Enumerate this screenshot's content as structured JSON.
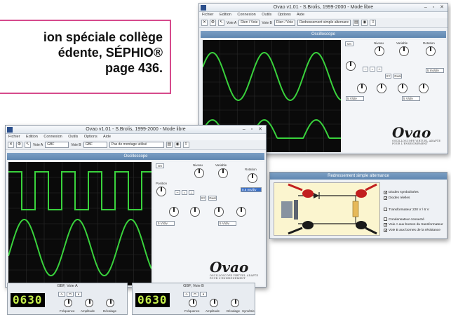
{
  "callout": {
    "line1": "ion spéciale collège",
    "line2": "édente, SÉPHIO®",
    "line3": "page 436."
  },
  "back_window": {
    "title": "Ovao v1.01 - S.Brolis, 1999-2000 - Mode libre",
    "menu": [
      "Fichier",
      "Edition",
      "Connexion",
      "Outils",
      "Options",
      "Aide"
    ],
    "voie_a_label": "Voie A",
    "voie_a_value": "Rien / Voie",
    "voie_b_label": "Voie B",
    "voie_b_value": "Rien / Voie",
    "montage": "Redressement simple alternanc",
    "scope_title": "Oscilloscope",
    "ctrl_labels": {
      "niveau": "Niveau",
      "variable": "Variable",
      "rotation": "Rotation"
    },
    "on_label": "On",
    "time_value": "5 ms/div",
    "volt_a": "5 V/div",
    "volt_b": "5 V/div",
    "logo": "Ovao",
    "logo_sub": "OSCILLOSCOPE VIRTUEL ADAPTE POUR L'ENSEIGNEMENT"
  },
  "front_window": {
    "title": "Ovao v1.01 - S.Brolis, 1999-2000 - Mode libre",
    "menu": [
      "Fichier",
      "Edition",
      "Connexion",
      "Outils",
      "Options",
      "Aide"
    ],
    "voie_a_label": "Voie A",
    "voie_a_value": "GBF",
    "voie_b_label": "Voie B",
    "voie_b_value": "GBF",
    "montage": "Pas de montage utilisé",
    "scope_title": "Oscilloscope",
    "ctrl_labels": {
      "niveau": "Niveau",
      "variable": "Variable",
      "rotation": "Rotation",
      "position": "Position"
    },
    "on_label": "On",
    "time_value": "0.5 ms/div",
    "volt_a": "5 V/div",
    "volt_b": "5 V/div",
    "logo": "Ovao",
    "logo_sub": "OSCILLOSCOPE VIRTUEL ADAPTE POUR L'ENSEIGNEMENT"
  },
  "gbf_a": {
    "title": "GBF, Voie A",
    "display": "0630",
    "knobs": [
      "Fréquence",
      "Amplitude",
      "Décalage"
    ]
  },
  "gbf_b": {
    "title": "GBF, Voie B",
    "display": "0630",
    "knobs": [
      "Fréquence",
      "Amplitude",
      "Décalage"
    ],
    "extra": "Symétrie"
  },
  "redressement": {
    "title": "Redressement simple alternance",
    "options": [
      {
        "label": "Diodes symbolisées",
        "checked": true
      },
      {
        "label": "Diodes réelles",
        "checked": true
      },
      {
        "label": "Transformateur 220 V / 6 V",
        "checked": false
      },
      {
        "label": "Condensateur connecté",
        "checked": false
      },
      {
        "label": "Voie A aux bornes du transformateur",
        "checked": true
      },
      {
        "label": "Voie B aux bornes de la résistance",
        "checked": true
      }
    ]
  },
  "colors": {
    "trace": "#39d23c",
    "callout_border": "#d64a8c",
    "panel_head": "#6a90b8"
  }
}
